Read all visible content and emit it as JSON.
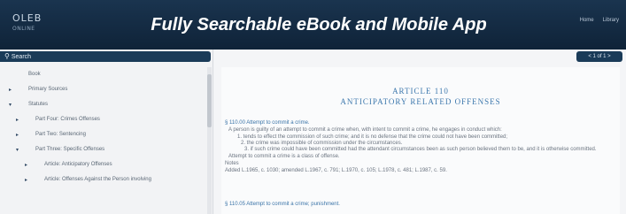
{
  "header": {
    "logo_text": "OLEB",
    "logo_sub": "ONLINE",
    "banner": "Fully Searchable eBook and Mobile App",
    "links": [
      "Home",
      "Library"
    ]
  },
  "sidebar": {
    "search_label": "Search",
    "toc": [
      {
        "label": "Book",
        "arrow": "",
        "indent": 0
      },
      {
        "label": "Primary Sources",
        "arrow": "▸",
        "indent": 0
      },
      {
        "label": "Statutes",
        "arrow": "▾",
        "indent": 0
      },
      {
        "label": "Part Four: Crimes Offenses",
        "arrow": "▸",
        "indent": 1
      },
      {
        "label": "Part Two: Sentencing",
        "arrow": "▸",
        "indent": 1
      },
      {
        "label": "Part Three: Specific Offenses",
        "arrow": "▾",
        "indent": 1
      },
      {
        "label": "Article: Anticipatory Offenses",
        "arrow": "▸",
        "indent": 2
      },
      {
        "label": "Article: Offenses Against the Person involving",
        "arrow": "▸",
        "indent": 2
      }
    ]
  },
  "pager": {
    "label": "< 1 of 1 >"
  },
  "article": {
    "heading_1": "ARTICLE 110",
    "heading_2": "ANTICIPATORY RELATED OFFENSES",
    "sections": [
      {
        "text": "§ 110.00 Attempt to commit a crime.",
        "style": "blue",
        "indent": 0
      },
      {
        "text": "A person is guilty of an attempt to commit a crime when, with intent to commit a crime, he engages in conduct which:",
        "style": "plain",
        "indent": 4
      },
      {
        "text": "1. tends to effect the commission of such crime; and it is no defense that the crime could not have been committed;",
        "style": "plain",
        "indent": 14
      },
      {
        "text": "2. the crime was impossible of commission under the circumstances.",
        "style": "plain",
        "indent": 18
      },
      {
        "text": "3. if such crime could have been committed had the attendant circumstances been as such person believed them to be, and it is otherwise committed.",
        "style": "plain",
        "indent": 22
      },
      {
        "text": "Attempt to commit a crime is a class of offense.",
        "style": "plain",
        "indent": 4
      },
      {
        "text": "Notes",
        "style": "plain",
        "indent": 0
      },
      {
        "text": "Added L.1965, c. 1030; amended L.1967, c. 791; L.1970, c. 105; L.1978, c. 481; L.1987, c. 59.",
        "style": "plain",
        "indent": 0
      },
      {
        "text": "§ 110.05 Attempt to commit a crime; punishment.",
        "style": "blue",
        "indent": 0
      }
    ]
  },
  "colors": {
    "header_bg": "#13293f",
    "bar_bg": "#1a3b58",
    "accent_blue": "#3b74a8"
  }
}
